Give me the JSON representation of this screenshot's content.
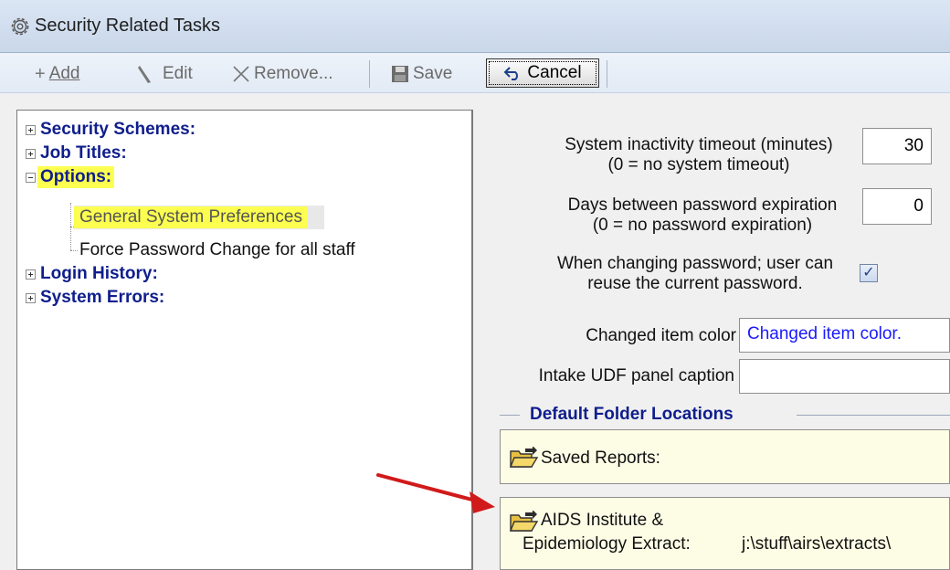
{
  "window": {
    "title": "Security Related Tasks",
    "title_icon": "gear-icon"
  },
  "toolbar": {
    "add": "Add",
    "edit": "Edit",
    "remove": "Remove...",
    "save": "Save",
    "cancel": "Cancel"
  },
  "tree": {
    "items": [
      {
        "label": "Security Schemes:",
        "expander": "plus"
      },
      {
        "label": "Job Titles:",
        "expander": "plus"
      },
      {
        "label": "Options:",
        "expander": "minus"
      },
      {
        "label": "General System Preferences"
      },
      {
        "label": "Force Password Change for all staff"
      },
      {
        "label": "Login History:",
        "expander": "plus"
      },
      {
        "label": "System Errors:",
        "expander": "plus"
      }
    ]
  },
  "settings": {
    "timeout_label_1": "System inactivity timeout (minutes)",
    "timeout_label_2": "(0 = no system timeout)",
    "timeout_value": "30",
    "expiration_label_1": "Days between password expiration",
    "expiration_label_2": "(0 = no password expiration)",
    "expiration_value": "0",
    "reuse_label_1": "When changing password; user can",
    "reuse_label_2": "reuse the current password.",
    "reuse_checked": true,
    "changed_color_label": "Changed item color",
    "changed_color_value": "Changed item color.",
    "changed_color_hex": "#1a1aff",
    "intake_label": "Intake UDF panel caption",
    "intake_value": ""
  },
  "folders": {
    "group_title": "Default Folder Locations",
    "saved_reports": "Saved Reports:",
    "aids_label_1": "AIDS Institute &",
    "aids_label_2": "Epidemiology  Extract:",
    "aids_path": "j:\\stuff\\airs\\extracts\\"
  },
  "colors": {
    "highlight": "#fcff50",
    "tree_bold": "#0f1e8c",
    "arrow": "#d11a1a"
  }
}
